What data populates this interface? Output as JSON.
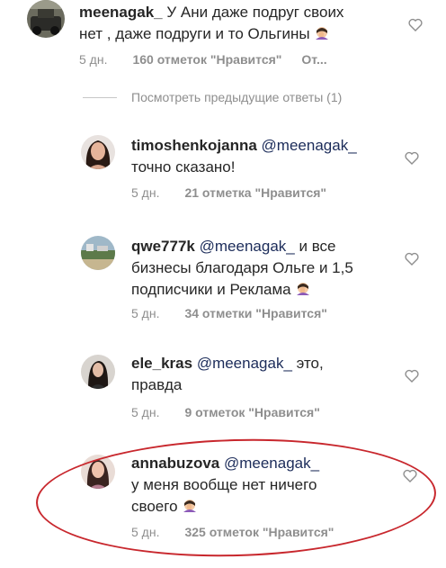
{
  "comments": [
    {
      "username": "meenagak_",
      "mention": "",
      "text_lines": [
        "У Ани даже подруг своих",
        "нет , даже подруги и то Ольгины"
      ],
      "age": "5 дн.",
      "likes": "160 отметок \"Нравится\"",
      "reply": "От..."
    },
    {
      "username": "timoshenkojanna",
      "mention": "@meenagak_",
      "text_lines": [
        "точно сказано!"
      ],
      "age": "5 дн.",
      "likes": "21 отметка \"Нравится\""
    },
    {
      "username": "qwe777k",
      "mention": "@meenagak_",
      "text_lines": [
        "и все",
        "бизнесы благодаря Ольге и 1,5",
        "подписчики и Реклама"
      ],
      "age": "5 дн.",
      "likes": "34 отметки \"Нравится\""
    },
    {
      "username": "ele_kras",
      "mention": "@meenagak_",
      "text_lines": [
        "это,",
        "правда"
      ],
      "age": "5 дн.",
      "likes": "9 отметок \"Нравится\""
    },
    {
      "username": "annabuzova",
      "mention": "@meenagak_",
      "text_lines": [
        "у меня вообще нет ничего",
        "своего"
      ],
      "age": "5 дн.",
      "likes": "325 отметок \"Нравится\""
    }
  ],
  "view_previous": "Посмотреть предыдущие ответы (1)",
  "icons": {
    "like": "heart-outline-icon",
    "emoji": "facepalm-emoji-icon"
  },
  "colors": {
    "highlight_circle": "#c8272d",
    "meta_text": "#8e8e8e"
  }
}
